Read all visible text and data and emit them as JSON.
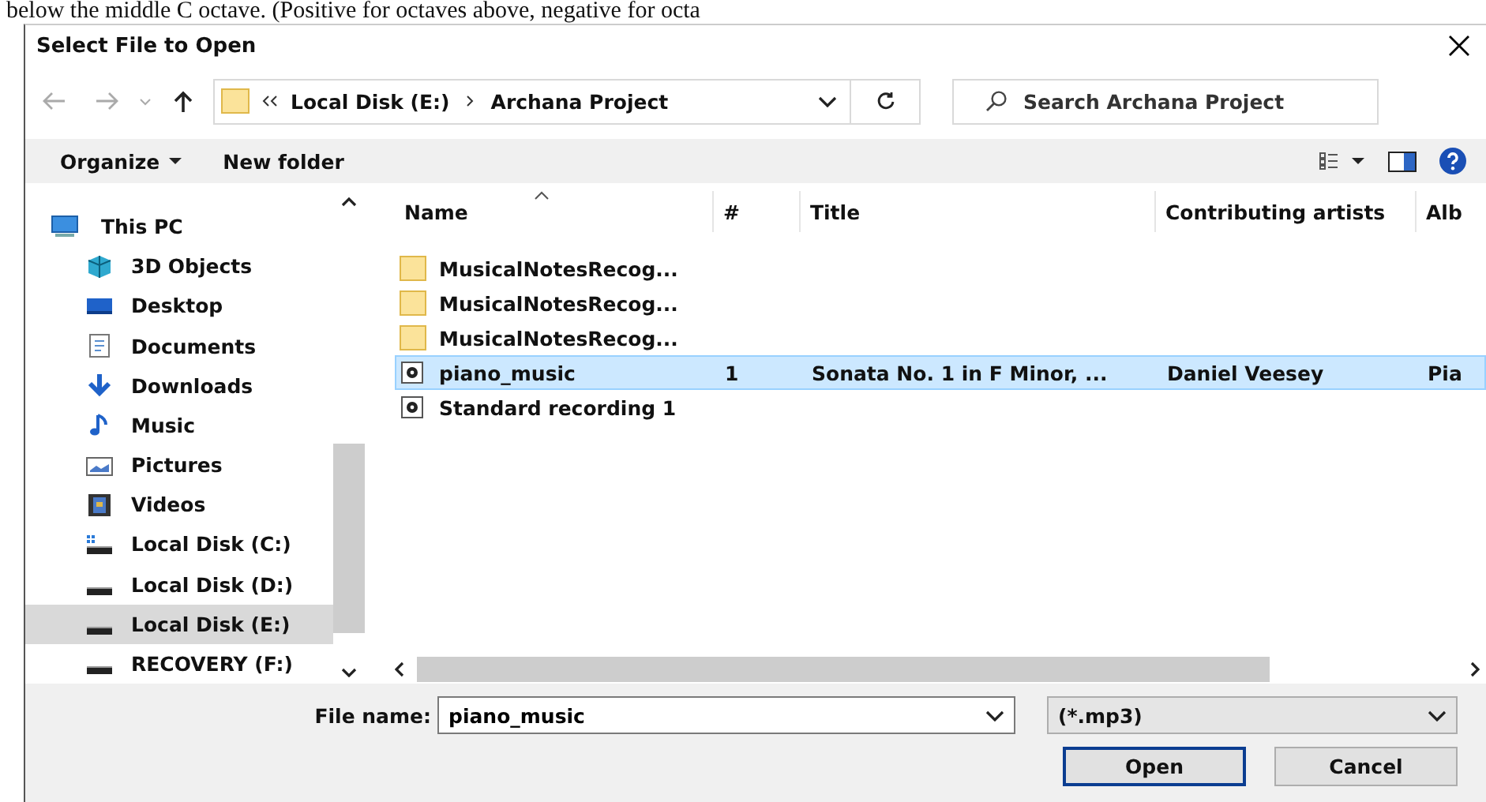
{
  "background_text": "below the middle C octave. (Positive for octaves above, negative for octa",
  "window": {
    "title": "Select File to Open"
  },
  "address": {
    "path": [
      "Local Disk (E:)",
      "Archana Project"
    ]
  },
  "search": {
    "placeholder": "Search Archana Project"
  },
  "toolbar": [
    "Organize",
    "New folder"
  ],
  "sidebar": {
    "items": [
      {
        "label": "This PC",
        "selected": false
      },
      {
        "label": "3D Objects",
        "selected": false
      },
      {
        "label": "Desktop",
        "selected": false
      },
      {
        "label": "Documents",
        "selected": false
      },
      {
        "label": "Downloads",
        "selected": false
      },
      {
        "label": "Music",
        "selected": false
      },
      {
        "label": "Pictures",
        "selected": false
      },
      {
        "label": "Videos",
        "selected": false
      },
      {
        "label": "Local Disk (C:)",
        "selected": false
      },
      {
        "label": "Local Disk (D:)",
        "selected": false
      },
      {
        "label": "Local Disk (E:)",
        "selected": true
      },
      {
        "label": "RECOVERY (F:)",
        "selected": false
      }
    ]
  },
  "table": {
    "columns": [
      "Name",
      "#",
      "Title",
      "Contributing artists",
      "Alb"
    ],
    "rows": [
      {
        "kind": "folder",
        "cells": [
          "MusicalNotesRecog...",
          "",
          "",
          "",
          ""
        ],
        "selected": false
      },
      {
        "kind": "folder",
        "cells": [
          "MusicalNotesRecog...",
          "",
          "",
          "",
          ""
        ],
        "selected": false
      },
      {
        "kind": "folder",
        "cells": [
          "MusicalNotesRecog...",
          "",
          "",
          "",
          ""
        ],
        "selected": false
      },
      {
        "kind": "audio",
        "cells": [
          "piano_music",
          "1",
          "Sonata No. 1 in F Minor, ...",
          "Daniel Veesey",
          "Pia"
        ],
        "selected": true
      },
      {
        "kind": "audio",
        "cells": [
          "Standard recording 1",
          "",
          "",
          "",
          ""
        ],
        "selected": false
      }
    ]
  },
  "file_name": {
    "label": "File name:",
    "value": "piano_music"
  },
  "file_type": {
    "value": "(*.mp3)"
  },
  "buttons": [
    {
      "label": "Open",
      "default": true
    },
    {
      "label": "Cancel",
      "default": false
    }
  ]
}
